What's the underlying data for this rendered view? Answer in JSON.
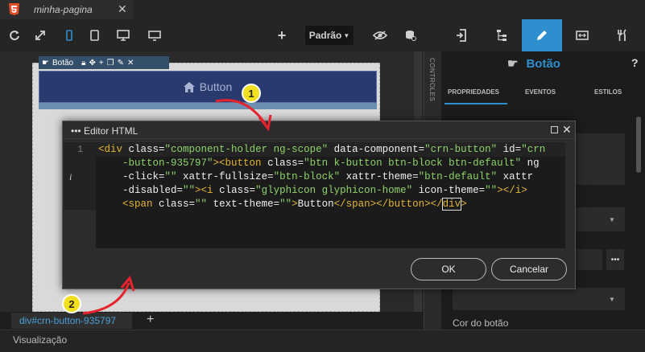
{
  "tab": {
    "title": "minha-pagina",
    "close": "✕"
  },
  "toolbar": {
    "viewport_select": "Padrão"
  },
  "component_bar": {
    "label": "Botão"
  },
  "preview_button": {
    "label": "Button"
  },
  "side_strip": {
    "label": "CONTROLES"
  },
  "right_panel": {
    "title": "Botão",
    "help": "?",
    "tabs": [
      "PROPRIEDADES",
      "EVENTOS",
      "ESTILOS"
    ],
    "more": "•••",
    "field_label": "Cor do botão"
  },
  "breadcrumb": {
    "path": "div#crn-button-935797",
    "add": "+"
  },
  "statusbar": {
    "label": "Visualização"
  },
  "dialog": {
    "title": "••• Editor HTML",
    "line_number": "1",
    "info_marker": "i",
    "ok_label": "OK",
    "cancel_label": "Cancelar"
  },
  "annotations": {
    "badge1": "1",
    "badge2": "2"
  },
  "colors": {
    "accent": "#2f8fce",
    "badge": "#f2e020",
    "arrow": "#e8222c"
  }
}
